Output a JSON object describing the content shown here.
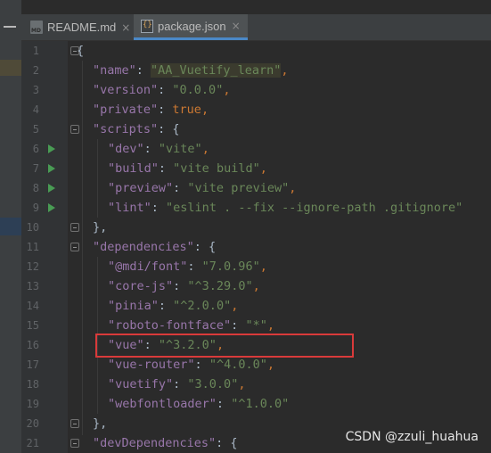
{
  "tabs": [
    {
      "label": "README.md",
      "icon": "markdown-file-icon",
      "active": false
    },
    {
      "label": "package.json",
      "icon": "json-file-icon",
      "active": true
    }
  ],
  "close_glyph": "×",
  "lines": [
    {
      "num": "1",
      "run": false,
      "fold": true
    },
    {
      "num": "2",
      "run": false,
      "fold": false
    },
    {
      "num": "3",
      "run": false,
      "fold": false
    },
    {
      "num": "4",
      "run": false,
      "fold": false
    },
    {
      "num": "5",
      "run": false,
      "fold": true
    },
    {
      "num": "6",
      "run": true,
      "fold": false
    },
    {
      "num": "7",
      "run": true,
      "fold": false
    },
    {
      "num": "8",
      "run": true,
      "fold": false
    },
    {
      "num": "9",
      "run": true,
      "fold": false
    },
    {
      "num": "10",
      "run": false,
      "fold": true
    },
    {
      "num": "11",
      "run": false,
      "fold": true
    },
    {
      "num": "12",
      "run": false,
      "fold": false
    },
    {
      "num": "13",
      "run": false,
      "fold": false
    },
    {
      "num": "14",
      "run": false,
      "fold": false
    },
    {
      "num": "15",
      "run": false,
      "fold": false
    },
    {
      "num": "16",
      "run": false,
      "fold": false
    },
    {
      "num": "17",
      "run": false,
      "fold": false
    },
    {
      "num": "18",
      "run": false,
      "fold": false
    },
    {
      "num": "19",
      "run": false,
      "fold": false
    },
    {
      "num": "20",
      "run": false,
      "fold": true
    },
    {
      "num": "21",
      "run": false,
      "fold": true
    }
  ],
  "code": {
    "brace_open": "{",
    "name_key": "\"name\"",
    "name_val": "\"AA_Vuetify_learn\"",
    "version_key": "\"version\"",
    "version_val": "\"0.0.0\"",
    "private_key": "\"private\"",
    "private_val": "true",
    "scripts_key": "\"scripts\"",
    "dev_key": "\"dev\"",
    "dev_val": "\"vite\"",
    "build_key": "\"build\"",
    "build_val": "\"vite build\"",
    "preview_key": "\"preview\"",
    "preview_val": "\"vite preview\"",
    "lint_key": "\"lint\"",
    "lint_val": "\"eslint . --fix --ignore-path .gitignore\"",
    "block_close": "},",
    "deps_key": "\"dependencies\"",
    "mdi_key": "\"@mdi/font\"",
    "mdi_val": "\"7.0.96\"",
    "corejs_key": "\"core-js\"",
    "corejs_val": "\"^3.29.0\"",
    "pinia_key": "\"pinia\"",
    "pinia_val": "\"^2.0.0\"",
    "roboto_key": "\"roboto-fontface\"",
    "roboto_val": "\"*\"",
    "vue_key": "\"vue\"",
    "vue_val": "\"^3.2.0\"",
    "vuerouter_key": "\"vue-router\"",
    "vuerouter_val": "\"^4.0.0\"",
    "vuetify_key": "\"vuetify\"",
    "vuetify_val": "\"3.0.0\"",
    "wfl_key": "\"webfontloader\"",
    "wfl_val": "\"^1.0.0\"",
    "devdeps_key": "\"devDependencies\""
  },
  "watermark": "CSDN @zzuli_huahua",
  "colors": {
    "key": "#9876aa",
    "string": "#6a8759",
    "keyword": "#cc7832",
    "annotation": "#d93a3a",
    "run_icon": "#499c54",
    "active_tab_underline": "#4a88c7"
  }
}
